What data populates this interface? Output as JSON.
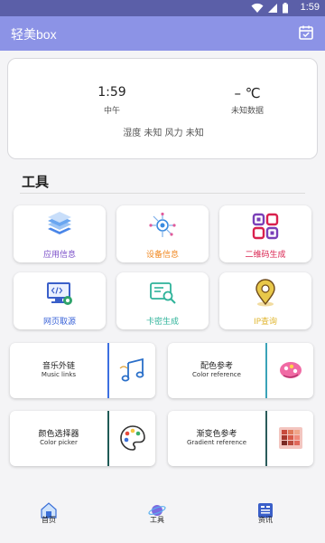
{
  "status_bar": {
    "time": "1:59"
  },
  "app_bar": {
    "title": "轻美box"
  },
  "weather": {
    "time": "1:59",
    "period": "中午",
    "temperature": "– ℃",
    "data_status": "未知数据",
    "detail_line": "湿度 未知 风力 未知"
  },
  "tools_section": {
    "title": "工具"
  },
  "tools": [
    {
      "label": "应用信息",
      "color": "#7b4fc9",
      "icon": "layers-icon"
    },
    {
      "label": "设备信息",
      "color": "#f08a24",
      "icon": "device-chip-icon"
    },
    {
      "label": "二维码生成",
      "color": "#d9214e",
      "icon": "qr-code-icon"
    },
    {
      "label": "网页取源",
      "color": "#3a63d8",
      "icon": "webpage-source-icon"
    },
    {
      "label": "卡密生成",
      "color": "#2fb39a",
      "icon": "key-card-icon"
    },
    {
      "label": "IP查询",
      "color": "#e8c84a",
      "icon": "location-pin-icon"
    }
  ],
  "cards": [
    {
      "title": "音乐外链",
      "subtitle": "Music links",
      "bar_color": "#3c6fe0",
      "icon": "music-note-icon"
    },
    {
      "title": "配色参考",
      "subtitle": "Color reference",
      "bar_color": "#3aa3b8",
      "icon": "paint-swatch-icon"
    },
    {
      "title": "颜色选择器",
      "subtitle": "Color picker",
      "bar_color": "#1f5a56",
      "icon": "palette-icon"
    },
    {
      "title": "渐变色参考",
      "subtitle": "Gradient reference",
      "bar_color": "#2a5b5a",
      "icon": "gradient-grid-icon"
    }
  ],
  "bottom_nav": [
    {
      "label": "首页",
      "icon": "home-icon"
    },
    {
      "label": "工具",
      "icon": "tools-planet-icon"
    },
    {
      "label": "资讯",
      "icon": "news-icon"
    }
  ]
}
